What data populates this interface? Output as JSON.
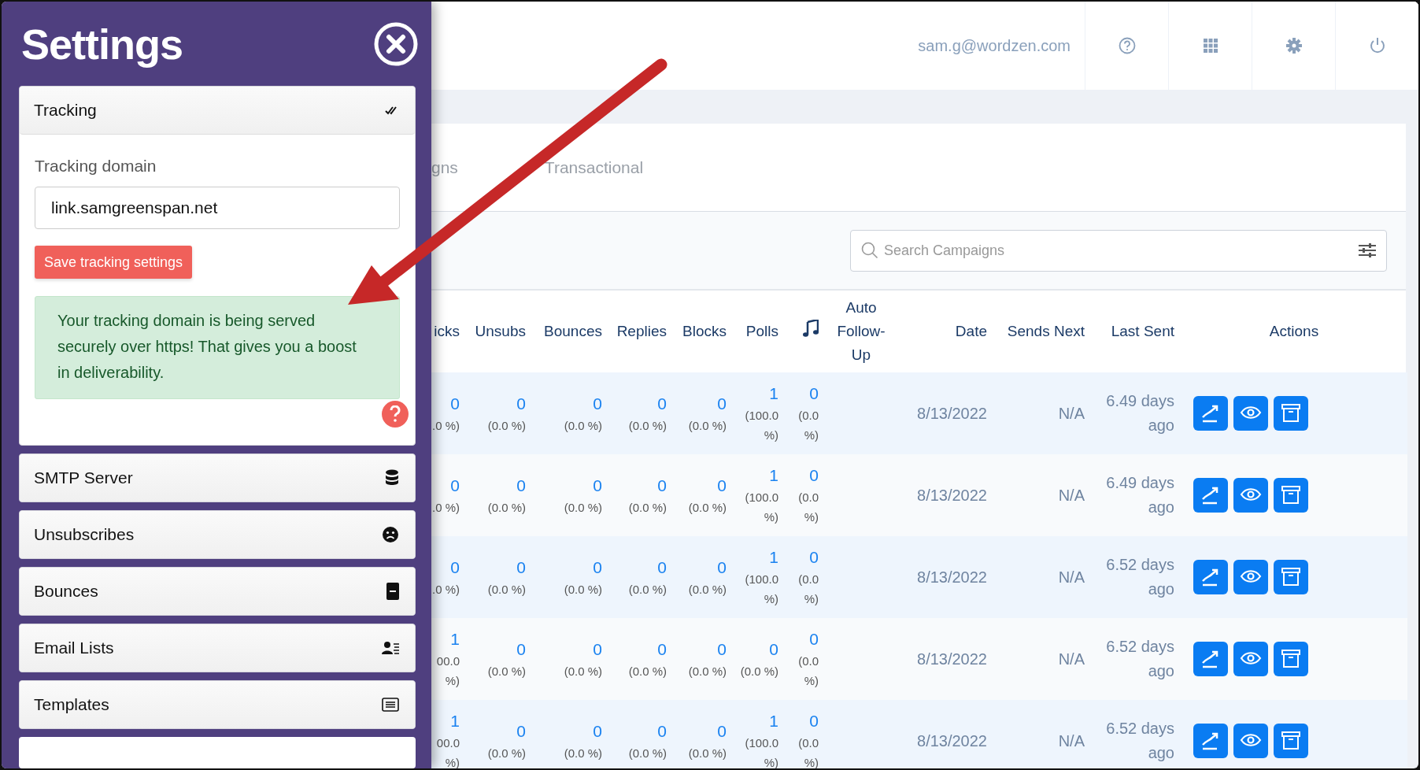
{
  "settings_panel": {
    "title": "Settings",
    "sections": [
      {
        "label": "Tracking",
        "expanded": true
      },
      {
        "label": "SMTP Server",
        "expanded": false
      },
      {
        "label": "Unsubscribes",
        "expanded": false
      },
      {
        "label": "Bounces",
        "expanded": false
      },
      {
        "label": "Email Lists",
        "expanded": false
      },
      {
        "label": "Templates",
        "expanded": false
      }
    ],
    "tracking": {
      "field_label": "Tracking domain",
      "value": "link.samgreenspan.net",
      "save_button": "Save tracking settings",
      "alert": "Your tracking domain is being served securely over https! That gives you a boost in deliverability."
    }
  },
  "top_bar": {
    "user_email": "sam.g@wordzen.com"
  },
  "tabs": [
    {
      "label": "gns"
    },
    {
      "label": "Transactional"
    }
  ],
  "search": {
    "placeholder": "Search Campaigns"
  },
  "table": {
    "columns": [
      {
        "kind": "text",
        "label": "icks"
      },
      {
        "kind": "text",
        "label": "Unsubs"
      },
      {
        "kind": "text",
        "label": "Bounces"
      },
      {
        "kind": "text",
        "label": "Replies"
      },
      {
        "kind": "text",
        "label": "Blocks"
      },
      {
        "kind": "text",
        "label": "Polls"
      },
      {
        "kind": "icon"
      },
      {
        "kind": "text",
        "label": "Auto Follow-Up"
      },
      {
        "kind": "text",
        "label": "Date"
      },
      {
        "kind": "text",
        "label": "Sends Next"
      },
      {
        "kind": "text",
        "label": "Last Sent"
      },
      {
        "kind": "text",
        "label": "Actions"
      }
    ],
    "rows": [
      {
        "stats": [
          {
            "count": "0",
            "share": ".0 %)"
          },
          {
            "count": "0",
            "share": "(0.0 %)"
          },
          {
            "count": "0",
            "share": "(0.0 %)"
          },
          {
            "count": "0",
            "share": "(0.0 %)"
          },
          {
            "count": "0",
            "share": "(0.0 %)"
          },
          {
            "count": "1",
            "share": "(100.0 %)"
          },
          {
            "count": "0",
            "share": "(0.0 %)"
          }
        ],
        "date": "8/13/2022",
        "sends_next": "N/A",
        "last_sent": "6.49 days ago"
      },
      {
        "stats": [
          {
            "count": "0",
            "share": ".0 %)"
          },
          {
            "count": "0",
            "share": "(0.0 %)"
          },
          {
            "count": "0",
            "share": "(0.0 %)"
          },
          {
            "count": "0",
            "share": "(0.0 %)"
          },
          {
            "count": "0",
            "share": "(0.0 %)"
          },
          {
            "count": "1",
            "share": "(100.0 %)"
          },
          {
            "count": "0",
            "share": "(0.0 %)"
          }
        ],
        "date": "8/13/2022",
        "sends_next": "N/A",
        "last_sent": "6.49 days ago"
      },
      {
        "stats": [
          {
            "count": "0",
            "share": ".0 %)"
          },
          {
            "count": "0",
            "share": "(0.0 %)"
          },
          {
            "count": "0",
            "share": "(0.0 %)"
          },
          {
            "count": "0",
            "share": "(0.0 %)"
          },
          {
            "count": "0",
            "share": "(0.0 %)"
          },
          {
            "count": "1",
            "share": "(100.0 %)"
          },
          {
            "count": "0",
            "share": "(0.0 %)"
          }
        ],
        "date": "8/13/2022",
        "sends_next": "N/A",
        "last_sent": "6.52 days ago"
      },
      {
        "stats": [
          {
            "count": "1",
            "share": "00.0 %)"
          },
          {
            "count": "0",
            "share": "(0.0 %)"
          },
          {
            "count": "0",
            "share": "(0.0 %)"
          },
          {
            "count": "0",
            "share": "(0.0 %)"
          },
          {
            "count": "0",
            "share": "(0.0 %)"
          },
          {
            "count": "0",
            "share": "(0.0 %)"
          },
          {
            "count": "0",
            "share": "(0.0 %)"
          }
        ],
        "date": "8/13/2022",
        "sends_next": "N/A",
        "last_sent": "6.52 days ago"
      },
      {
        "stats": [
          {
            "count": "1",
            "share": "00.0 %)"
          },
          {
            "count": "0",
            "share": "(0.0 %)"
          },
          {
            "count": "0",
            "share": "(0.0 %)"
          },
          {
            "count": "0",
            "share": "(0.0 %)"
          },
          {
            "count": "0",
            "share": "(0.0 %)"
          },
          {
            "count": "1",
            "share": "(100.0 %)"
          },
          {
            "count": "0",
            "share": "(0.0 %)"
          }
        ],
        "date": "8/13/2022",
        "sends_next": "N/A",
        "last_sent": "6.52 days ago"
      }
    ]
  },
  "annotations": [
    {
      "kind": "arrow"
    }
  ]
}
